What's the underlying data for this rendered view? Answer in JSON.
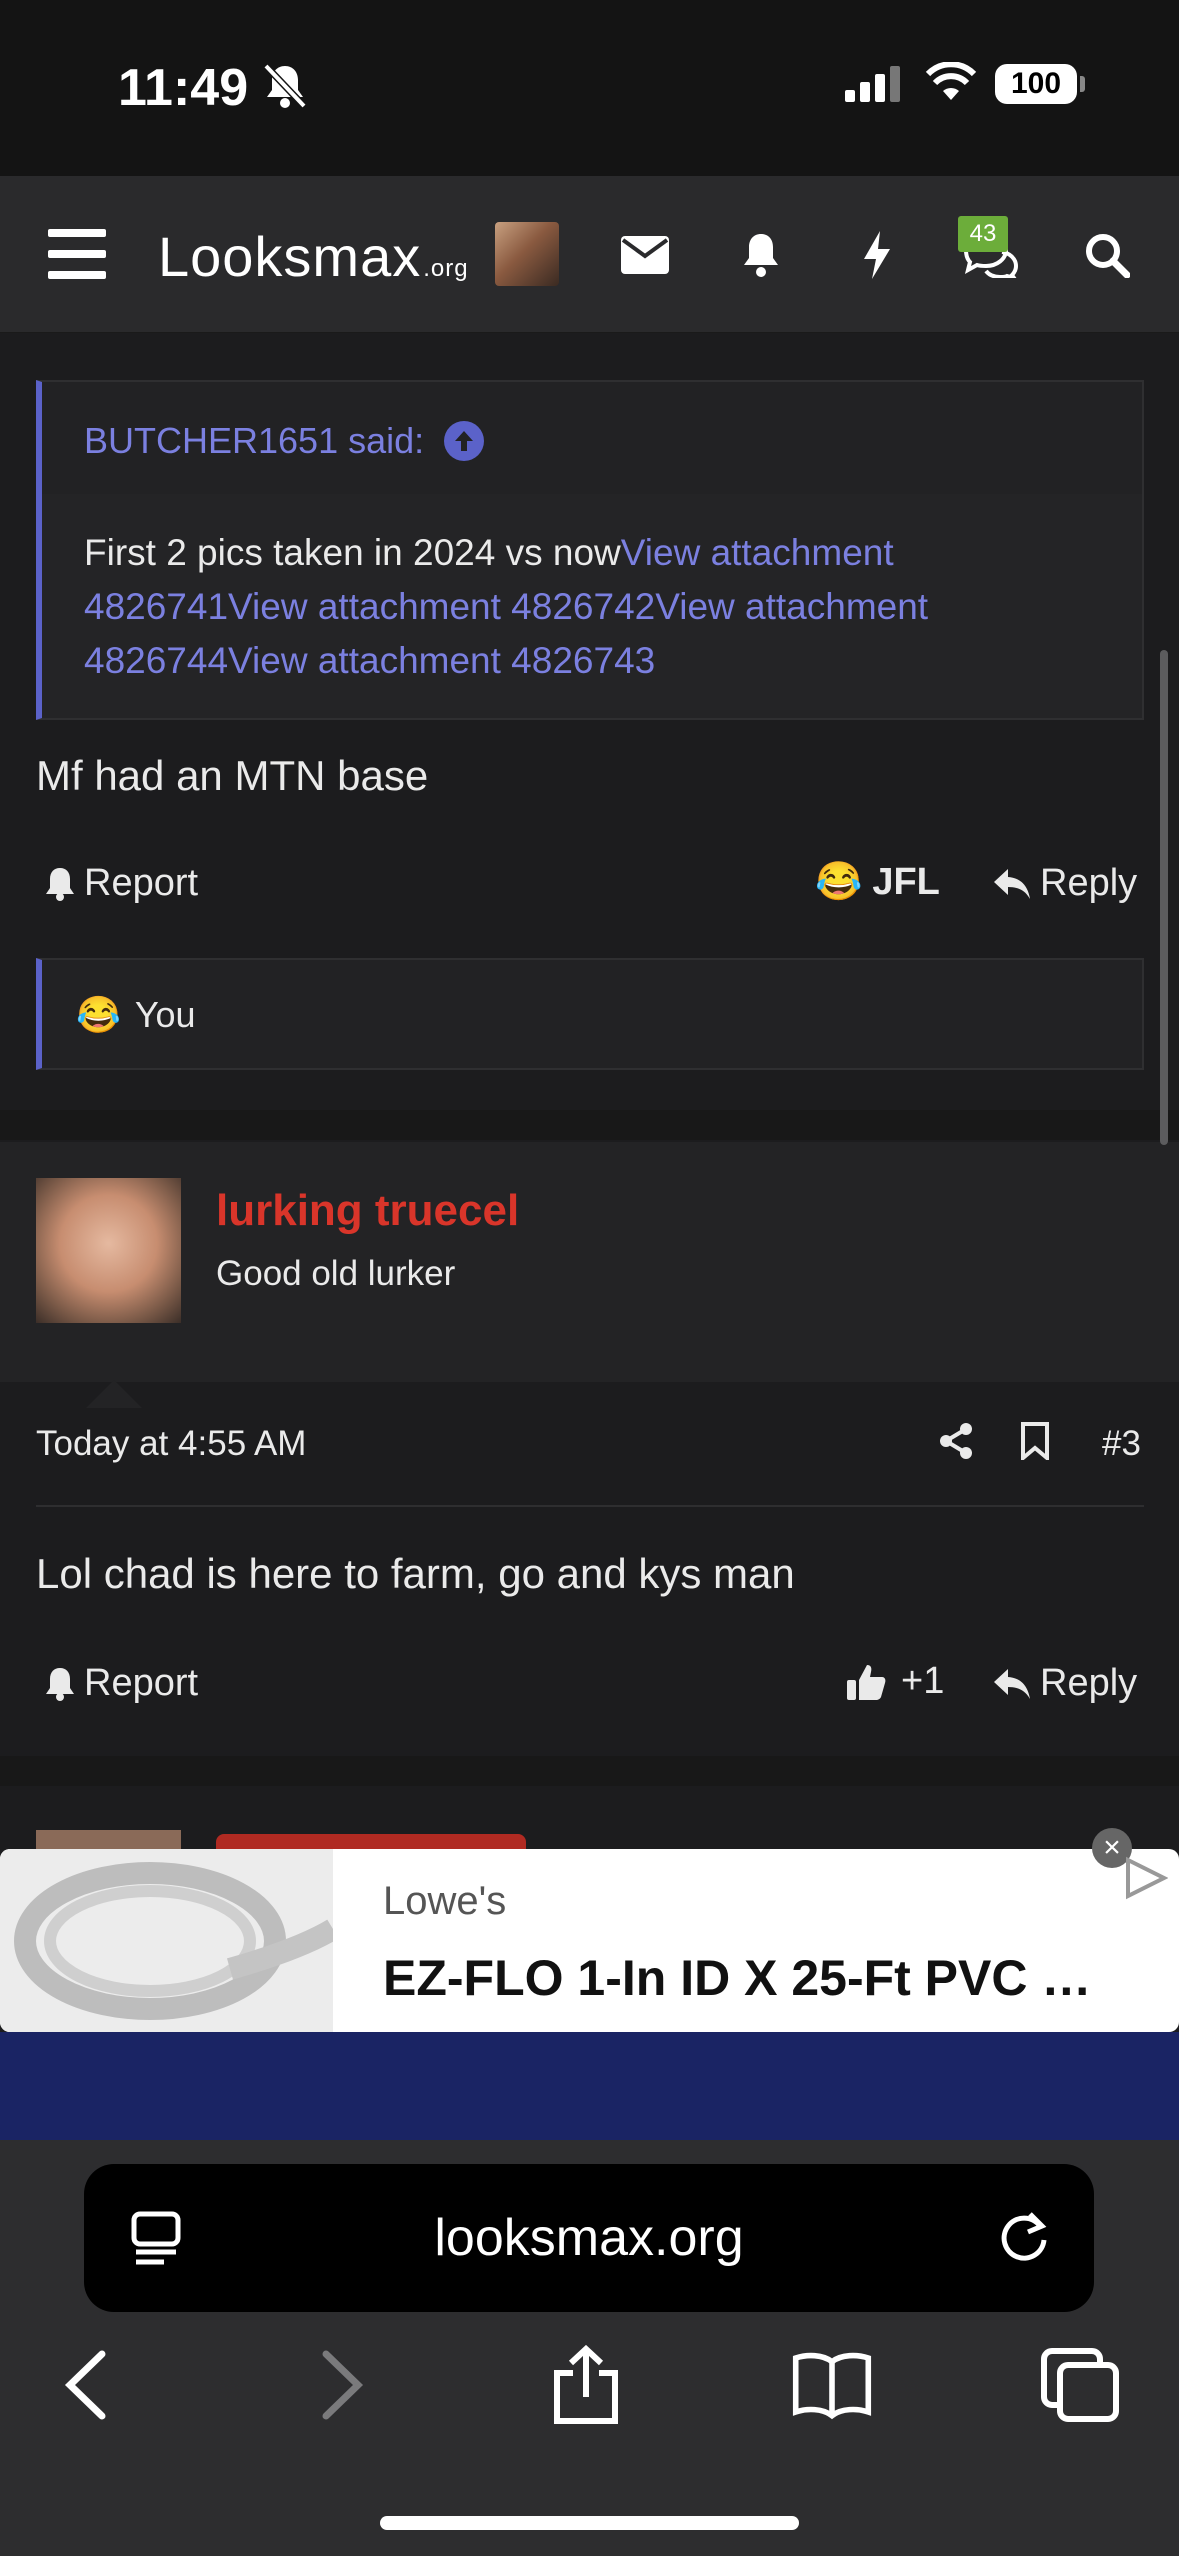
{
  "status_bar": {
    "time": "11:49",
    "battery": "100"
  },
  "header": {
    "logo_main": "Looksmax",
    "logo_suffix": ".org",
    "conversations_badge": "43"
  },
  "quote": {
    "author": "BUTCHER1651 said:",
    "text_plain": "First 2 pics taken in 2024 vs now",
    "links": [
      "View attachment 4826741",
      "View attachment 4826742",
      "View attachment 4826744",
      "View attachment 4826743"
    ]
  },
  "post1": {
    "body": "Mf had an MTN base",
    "report_label": "Report",
    "reaction_label": "JFL",
    "reaction_emoji": "😂",
    "reply_label": "Reply",
    "reacted_by": "You"
  },
  "post2": {
    "author": "lurking truecel",
    "author_title": "Good old lurker",
    "timestamp": "Today at 4:55 AM",
    "post_number": "#3",
    "body": "Lol chad is here to farm, go and kys man",
    "report_label": "Report",
    "like_count": "+1",
    "reply_label": "Reply"
  },
  "ad": {
    "brand": "Lowe's",
    "title": "EZ-FLO 1-In ID X 25-Ft PVC …"
  },
  "browser": {
    "url": "looksmax.org"
  },
  "colors": {
    "accent_link": "#7b80e0",
    "quote_border": "#5b62c9",
    "author_name": "#d9352a",
    "badge": "#6cad3a",
    "ad_band": "#1a2464"
  }
}
